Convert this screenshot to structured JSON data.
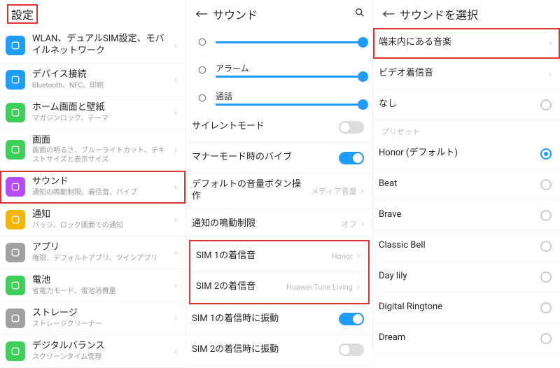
{
  "col1": {
    "title": "設定",
    "items": [
      {
        "label": "WLAN、デュアルSIM設定、モバイルネットワーク",
        "sub": "",
        "color": "#1e9cff",
        "icon": "wifi-icon"
      },
      {
        "label": "デバイス接続",
        "sub": "Bluetooth、NFC、印刷",
        "color": "#1e9cff",
        "icon": "devices-icon"
      },
      {
        "label": "ホーム画面と壁紙",
        "sub": "マガジンロック、テーマ",
        "color": "#3ecf5b",
        "icon": "home-icon"
      },
      {
        "label": "画面",
        "sub": "画面の明るさ、ブルーライトカット、テキストサイズと表示サイズ",
        "color": "#3ecf5b",
        "icon": "display-icon"
      },
      {
        "label": "サウンド",
        "sub": "通知の鳴動制限、着信音、バイブ",
        "color": "#b44bff",
        "icon": "sound-icon",
        "highlight": true
      },
      {
        "label": "通知",
        "sub": "バッジ、ロック画面での通知",
        "color": "#f5b400",
        "icon": "notification-icon"
      },
      {
        "label": "アプリ",
        "sub": "権限、デフォルトアプリ、ツインアプリ",
        "color": "#a0a0a0",
        "icon": "apps-icon"
      },
      {
        "label": "電池",
        "sub": "省電力モード、電池消費量",
        "color": "#3ecf5b",
        "icon": "battery-icon"
      },
      {
        "label": "ストレージ",
        "sub": "ストレージクリーナー",
        "color": "#a0a0a0",
        "icon": "storage-icon"
      },
      {
        "label": "デジタルバランス",
        "sub": "スクリーンタイム管理",
        "color": "#3ecf5b",
        "icon": "balance-icon"
      }
    ]
  },
  "col2": {
    "title": "サウンド",
    "sliders": [
      {
        "label": "",
        "icon": "bell-icon"
      },
      {
        "label": "アラーム",
        "icon": "alarm-icon"
      },
      {
        "label": "通話",
        "icon": "call-icon"
      }
    ],
    "rows": [
      {
        "label": "サイレントモード",
        "type": "toggle",
        "on": false
      },
      {
        "label": "マナーモード時のバイブ",
        "type": "toggle",
        "on": true
      },
      {
        "label": "デフォルトの音量ボタン操作",
        "type": "link",
        "value": "メディア音量"
      },
      {
        "label": "通知の鳴動制限",
        "type": "link",
        "value": "オフ"
      },
      {
        "label": "SIM 1の着信音",
        "type": "link",
        "value": "Honor",
        "hl": true
      },
      {
        "label": "SIM 2の着信音",
        "type": "link",
        "value": "Huawei Tune Living",
        "hl": true
      },
      {
        "label": "SIM 1の着信時に振動",
        "type": "toggle",
        "on": true
      },
      {
        "label": "SIM 2の着信時に振動",
        "type": "toggle",
        "on": false
      }
    ]
  },
  "col3": {
    "title": "サウンドを選択",
    "top": [
      {
        "label": "端末内にある音楽",
        "type": "link",
        "highlight": true
      },
      {
        "label": "ビデオ着信音",
        "type": "link"
      },
      {
        "label": "なし",
        "type": "radio",
        "selected": false
      }
    ],
    "section": "プリセット",
    "presets": [
      {
        "label": "Honor (デフォルト)",
        "selected": true
      },
      {
        "label": "Beat",
        "selected": false
      },
      {
        "label": "Brave",
        "selected": false
      },
      {
        "label": "Classic Bell",
        "selected": false
      },
      {
        "label": "Day lily",
        "selected": false
      },
      {
        "label": "Digital Ringtone",
        "selected": false
      },
      {
        "label": "Dream",
        "selected": false
      }
    ]
  }
}
